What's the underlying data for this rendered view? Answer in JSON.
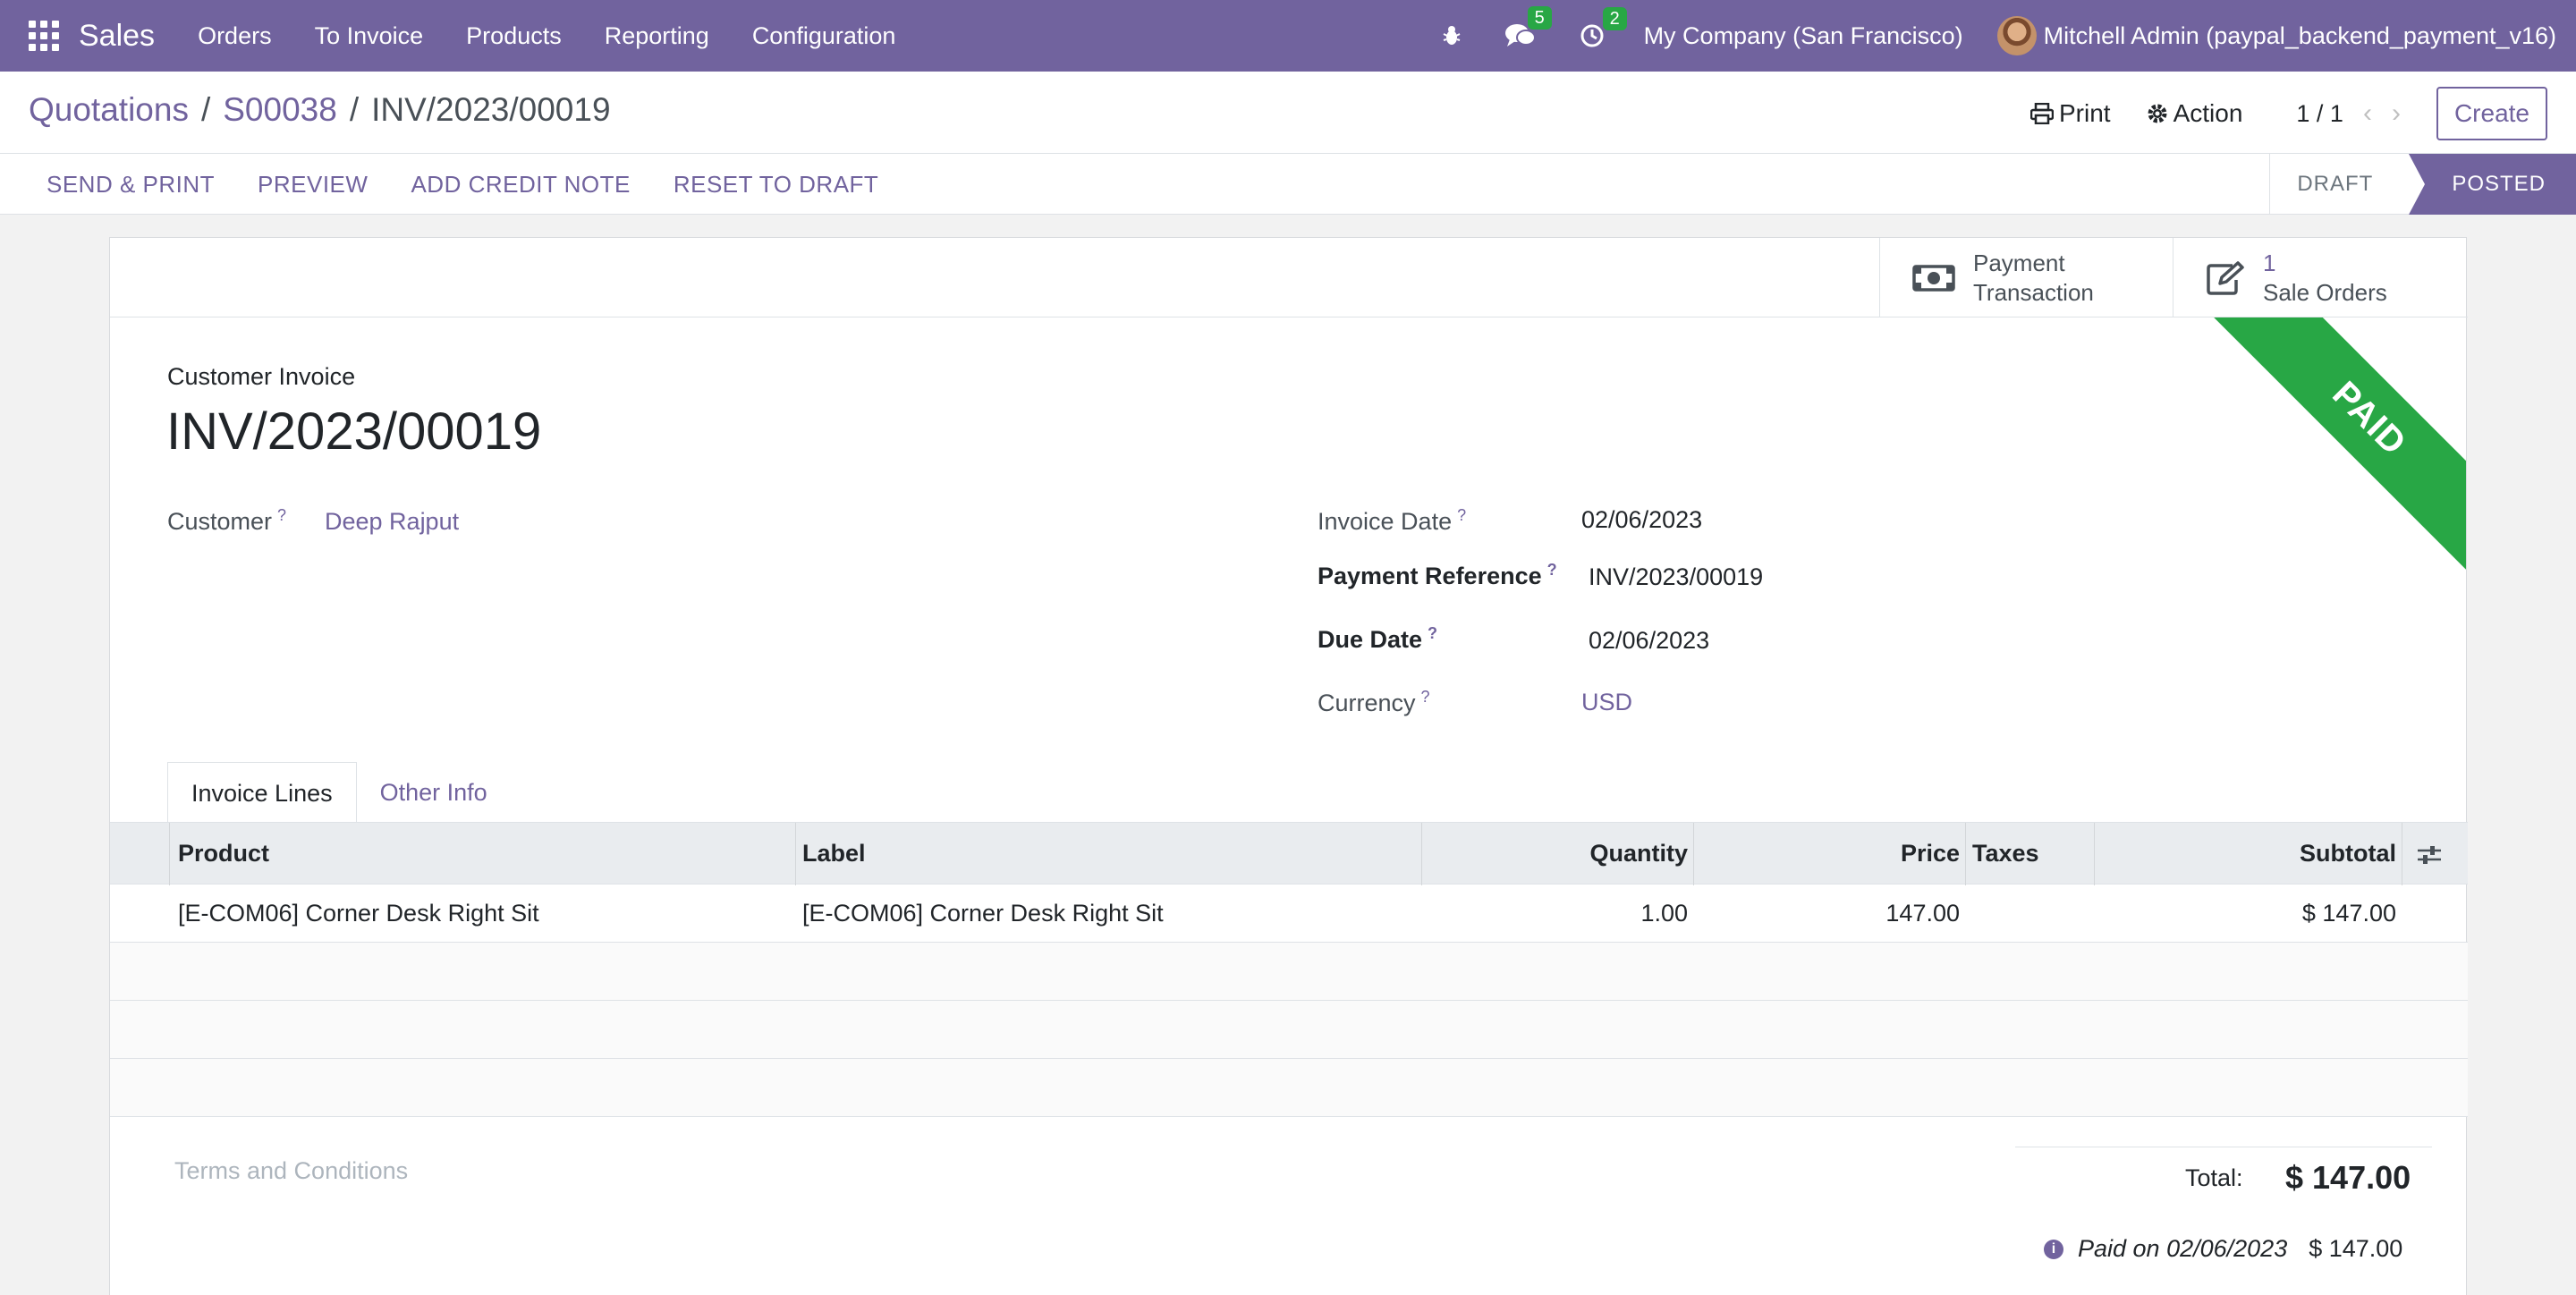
{
  "navbar": {
    "brand": "Sales",
    "menu": [
      "Orders",
      "To Invoice",
      "Products",
      "Reporting",
      "Configuration"
    ],
    "messages_count": "5",
    "activities_count": "2",
    "company": "My Company (San Francisco)",
    "user": "Mitchell Admin (paypal_backend_payment_v16)",
    "accent_color": "#71639e"
  },
  "control_panel": {
    "breadcrumb": [
      "Quotations",
      "S00038",
      "INV/2023/00019"
    ],
    "print_label": "Print",
    "action_label": "Action",
    "pager": "1 / 1",
    "create_label": "Create"
  },
  "statusbar": {
    "actions": [
      "SEND & PRINT",
      "PREVIEW",
      "ADD CREDIT NOTE",
      "RESET TO DRAFT"
    ],
    "stages": [
      "DRAFT",
      "POSTED"
    ],
    "current_stage": "POSTED"
  },
  "smart_buttons": {
    "payment_line1": "Payment",
    "payment_line2": "Transaction",
    "sale_orders_count": "1",
    "sale_orders_label": "Sale Orders"
  },
  "ribbon": {
    "text": "PAID",
    "color": "#28a745"
  },
  "invoice": {
    "doc_type": "Customer Invoice",
    "name": "INV/2023/00019",
    "customer_label": "Customer",
    "customer": "Deep Rajput",
    "invoice_date_label": "Invoice Date",
    "invoice_date": "02/06/2023",
    "payment_ref_label": "Payment Reference",
    "payment_ref": "INV/2023/00019",
    "due_date_label": "Due Date",
    "due_date": "02/06/2023",
    "currency_label": "Currency",
    "currency": "USD",
    "help_mark": "?"
  },
  "tabs": [
    "Invoice Lines",
    "Other Info"
  ],
  "lines": {
    "headers": {
      "product": "Product",
      "label": "Label",
      "quantity": "Quantity",
      "price": "Price",
      "taxes": "Taxes",
      "subtotal": "Subtotal"
    },
    "rows": [
      {
        "product": "[E-COM06] Corner Desk Right Sit",
        "label": "[E-COM06] Corner Desk Right Sit",
        "quantity": "1.00",
        "price": "147.00",
        "taxes": "",
        "subtotal": "$ 147.00"
      }
    ]
  },
  "footer": {
    "terms_placeholder": "Terms and Conditions",
    "total_label": "Total:",
    "total_value": "$ 147.00",
    "paid_on": "Paid on 02/06/2023",
    "paid_amount": "$ 147.00"
  }
}
